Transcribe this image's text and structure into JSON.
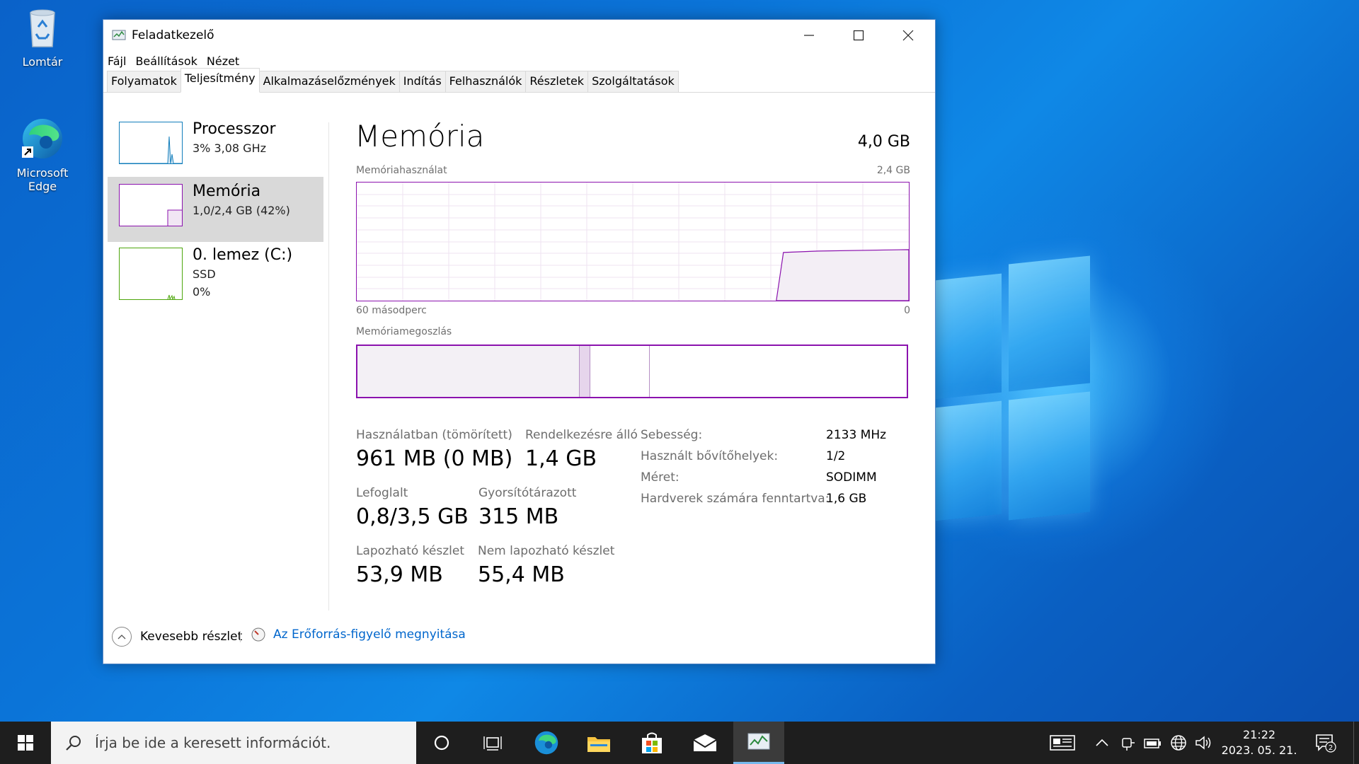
{
  "desktop": {
    "icons": [
      {
        "label": "Lomtár"
      },
      {
        "label": "Microsoft Edge"
      }
    ]
  },
  "window": {
    "title": "Feladatkezelő",
    "menu": [
      "Fájl",
      "Beállítások",
      "Nézet"
    ],
    "tabs": [
      "Folyamatok",
      "Teljesítmény",
      "Alkalmazáselőzmények",
      "Indítás",
      "Felhasználók",
      "Részletek",
      "Szolgáltatások"
    ],
    "active_tab": "Teljesítmény"
  },
  "left_panel": {
    "items": [
      {
        "name": "Processzor",
        "sub1": "3%  3,08 GHz",
        "sub2": "",
        "color": "#117dbb"
      },
      {
        "name": "Memória",
        "sub1": "1,0/2,4 GB (42%)",
        "sub2": "",
        "color": "#8b12ae"
      },
      {
        "name": "0. lemez (C:)",
        "sub1": "SSD",
        "sub2": "0%",
        "color": "#4da60c"
      }
    ]
  },
  "memory": {
    "title": "Memória",
    "total": "4,0 GB",
    "usage_label": "Memóriahasználat",
    "usage_max": "2,4 GB",
    "time_left": "60 másodperc",
    "time_right": "0",
    "composition_label": "Memóriamegoszlás",
    "usage_level": 0.42,
    "stats": {
      "in_use_label": "Használatban (tömörített)",
      "in_use_value": "961 MB (0 MB)",
      "available_label": "Rendelkezésre álló",
      "available_value": "1,4 GB",
      "committed_label": "Lefoglalt",
      "committed_value": "0,8/3,5 GB",
      "cached_label": "Gyorsítótárazott",
      "cached_value": "315 MB",
      "paged_label": "Lapozható készlet",
      "paged_value": "53,9 MB",
      "nonpaged_label": "Nem lapozható készlet",
      "nonpaged_value": "55,4 MB"
    },
    "details": [
      {
        "label": "Sebesség:",
        "value": "2133 MHz"
      },
      {
        "label": "Használt bővítőhelyek:",
        "value": "1/2"
      },
      {
        "label": "Méret:",
        "value": "SODIMM"
      },
      {
        "label": "Hardverek számára fenntartva:",
        "value": "1,6 GB"
      }
    ]
  },
  "footer": {
    "fewer_details": "Kevesebb részlet",
    "resource_monitor": "Az Erőforrás-figyelő megnyitása"
  },
  "taskbar": {
    "search_placeholder": "Írja be ide a keresett információt.",
    "time": "21:22",
    "date": "2023. 05. 21.",
    "notification_count": "2"
  },
  "colors": {
    "memory": "#8b12ae",
    "cpu": "#117dbb",
    "disk": "#4da60c",
    "link": "#0066cc"
  }
}
